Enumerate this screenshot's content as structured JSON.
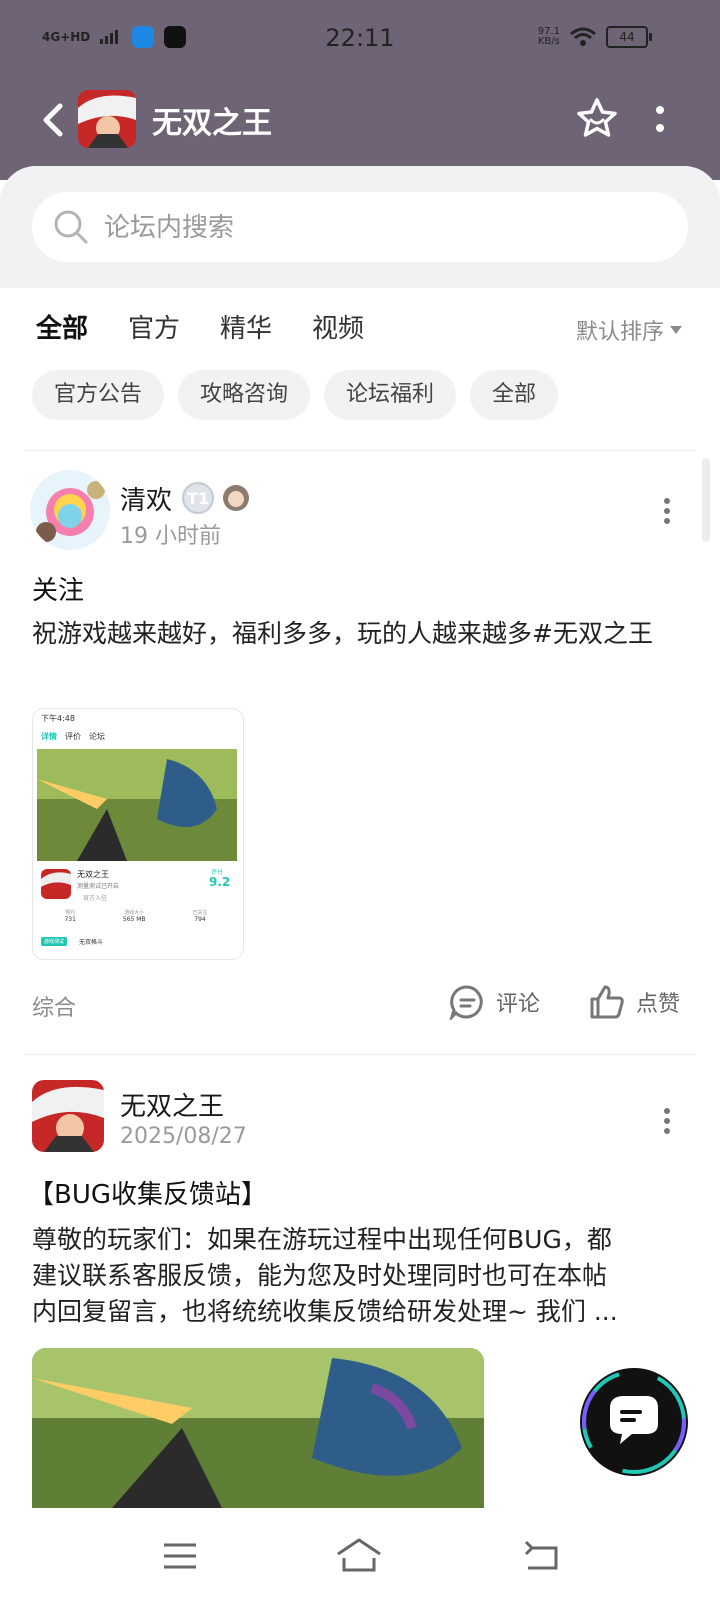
{
  "status_bar": {
    "network": "4G+HD",
    "time": "22:11",
    "speed_value": "97.1",
    "speed_unit": "KB/s",
    "battery": "44"
  },
  "header": {
    "title": "无双之王",
    "back_icon": "chevron-left-icon",
    "favorite_icon": "star-outline-icon",
    "more_icon": "vertical-dots-icon"
  },
  "search": {
    "placeholder": "论坛内搜索"
  },
  "tabs": [
    {
      "label": "全部",
      "active": true
    },
    {
      "label": "官方",
      "active": false
    },
    {
      "label": "精华",
      "active": false
    },
    {
      "label": "视频",
      "active": false
    }
  ],
  "sort": {
    "label": "默认排序"
  },
  "chips": [
    "官方公告",
    "攻略咨询",
    "论坛福利",
    "全部"
  ],
  "posts": [
    {
      "author": "清欢",
      "badge": "T1",
      "time": "19 小时前",
      "title": "关注",
      "body": "祝游戏越来越好，福利多多，玩的人越来越多#无双之王",
      "category": "综合",
      "comment_label": "评论",
      "like_label": "点赞",
      "thumbnail": {
        "time": "下午4:48",
        "tabs": [
          "详情",
          "评价",
          "论坛"
        ],
        "game_name": "无双之王",
        "subtitle": "测量测试已开启",
        "official": "官方入驻",
        "score_label": "评分",
        "score": "9.2",
        "stats": [
          {
            "label": "预约",
            "value": "731"
          },
          {
            "label": "游戏大小",
            "value": "565 MB"
          },
          {
            "label": "已关注",
            "value": "794"
          }
        ],
        "tag": "游戏测试",
        "tag2": "无双格斗"
      }
    },
    {
      "author": "无双之王",
      "time": "2025/08/27",
      "title": "【BUG收集反馈站】",
      "body_lines": [
        "尊敬的玩家们：如果在游玩过程中出现任何BUG，都",
        "建议联系客服反馈，能为您及时处理同时也可在本帖",
        "内回复留言，也将统统收集反馈给研发处理~ 我们 ..."
      ]
    }
  ],
  "colors": {
    "header_bg": "#6f6476",
    "accent": "#1fc7b4",
    "chip_bg": "#f2f2f4"
  }
}
